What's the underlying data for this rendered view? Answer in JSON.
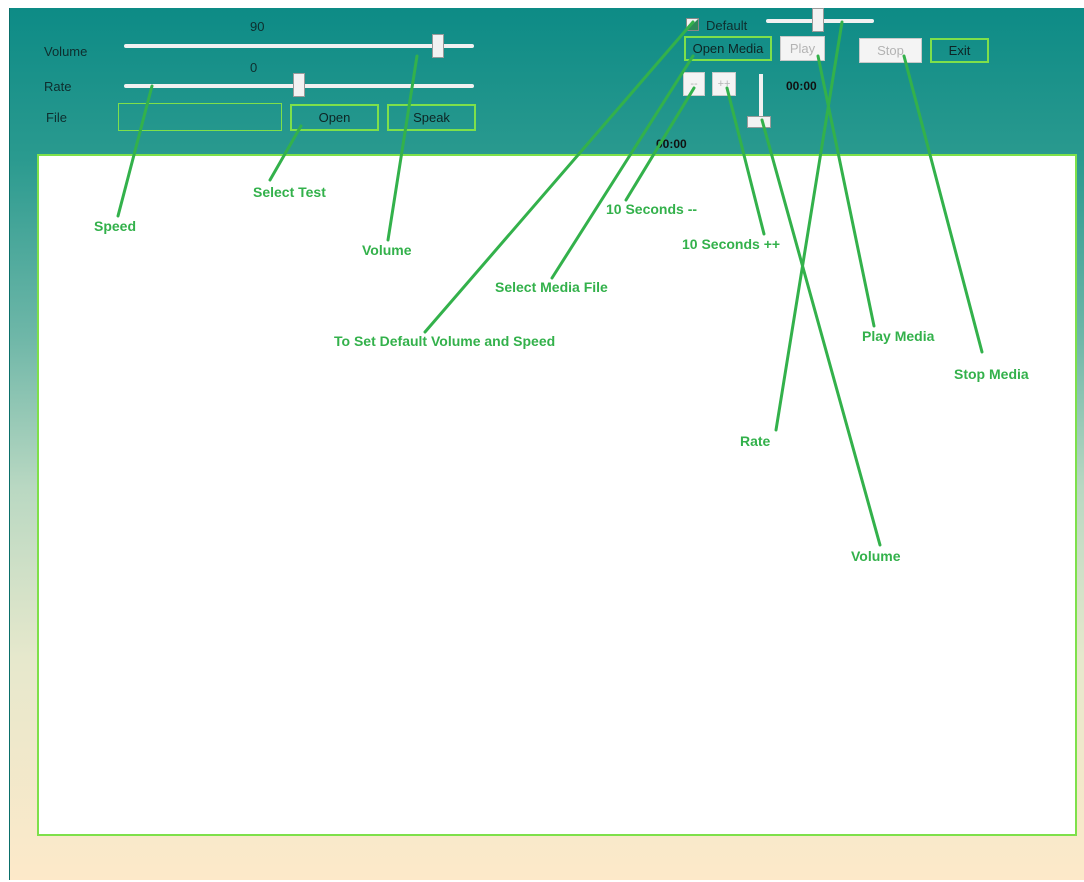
{
  "tts": {
    "volume_label": "Volume",
    "volume_value": "90",
    "rate_label": "Rate",
    "rate_value": "0",
    "file_label": "File",
    "file_input_value": "",
    "open_label": "Open",
    "speak_label": "Speak"
  },
  "media": {
    "default_label": "Default",
    "open_media_label": "Open Media",
    "play_label": "Play",
    "stop_label": "Stop",
    "exit_label": "Exit",
    "back_label": "--",
    "forward_label": "++",
    "current_time": "00:00",
    "total_time": "00:00"
  },
  "annotations": {
    "speed": "Speed",
    "select_test": "Select Test",
    "volume": "Volume",
    "default_volume_speed": "To Set Default Volume and Speed",
    "select_media_file": "Select Media File",
    "ten_seconds_back": "10 Seconds --",
    "ten_seconds_forward": "10 Seconds ++",
    "play_media": "Play Media",
    "stop_media": "Stop Media",
    "rate": "Rate",
    "media_volume": "Volume"
  },
  "colors": {
    "header_teal": "#0d8b86",
    "bottom_cream": "#fde9c9",
    "border_green": "#7ee04a",
    "annotation_green": "#33b14b"
  }
}
